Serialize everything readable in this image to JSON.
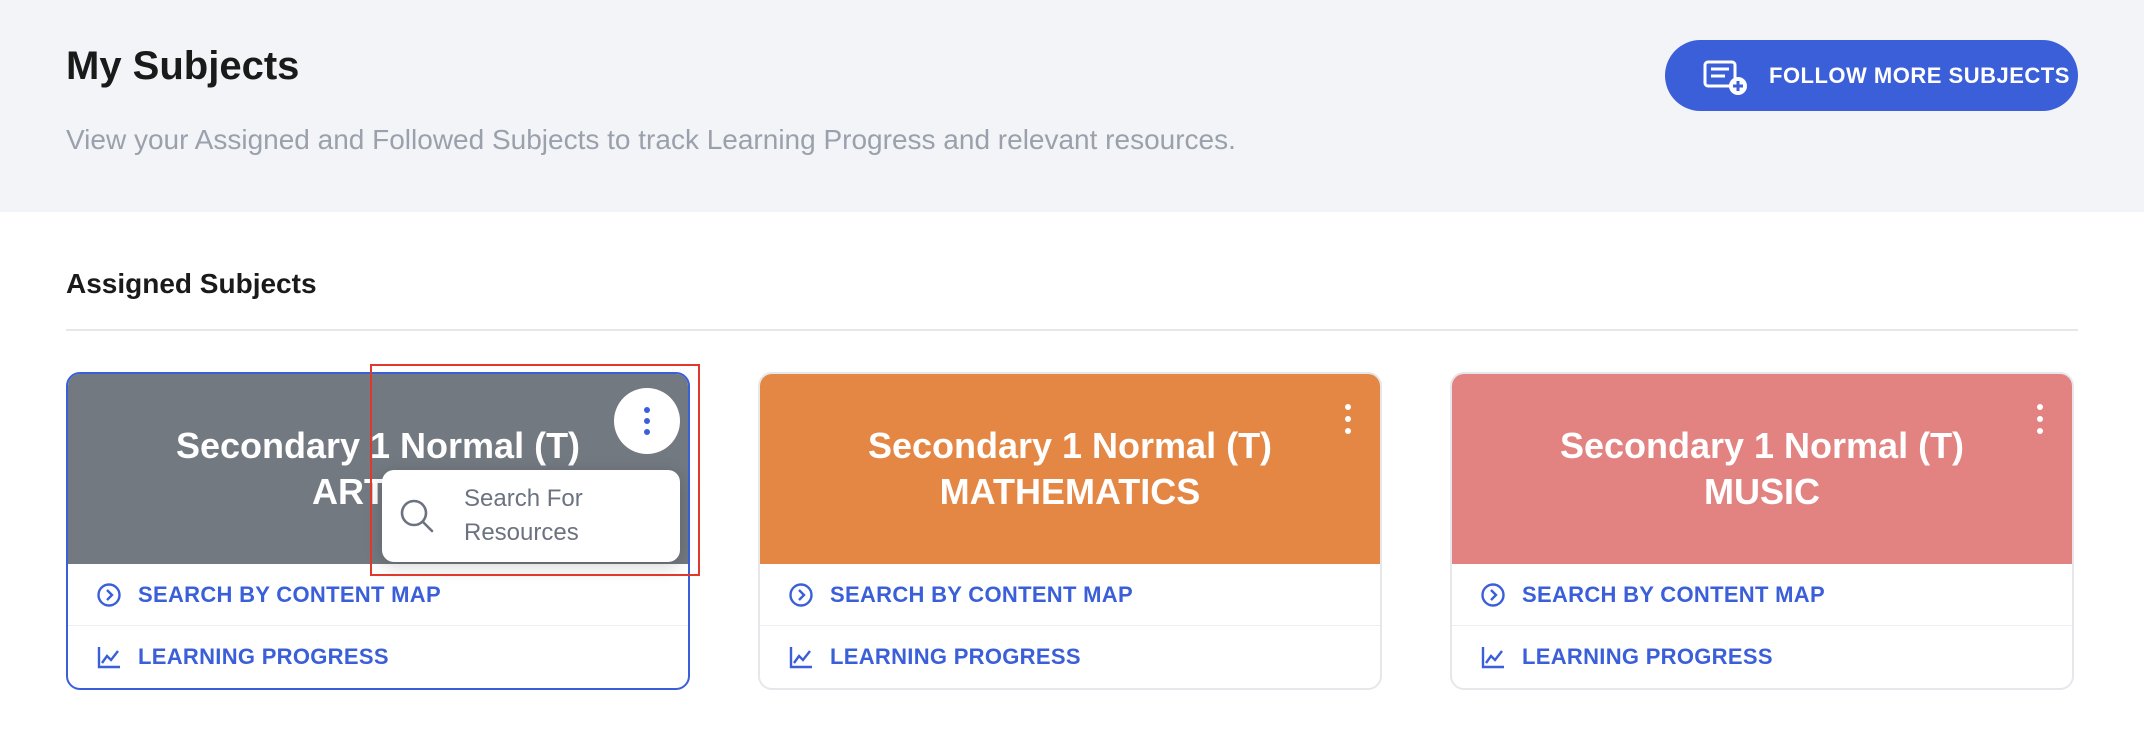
{
  "header": {
    "title": "My Subjects",
    "subtitle": "View your Assigned and Followed Subjects to track Learning Progress and relevant resources.",
    "follow_button_label": "FOLLOW MORE SUBJECTS"
  },
  "section": {
    "title": "Assigned Subjects"
  },
  "cards": [
    {
      "line1": "Secondary 1 Normal (T)",
      "line2": "ART NT",
      "color": "#737980",
      "content_map_label": "SEARCH BY CONTENT MAP",
      "progress_label": "LEARNING PROGRESS"
    },
    {
      "line1": "Secondary 1 Normal (T)",
      "line2": "MATHEMATICS",
      "color": "#e58744",
      "content_map_label": "SEARCH BY CONTENT MAP",
      "progress_label": "LEARNING PROGRESS"
    },
    {
      "line1": "Secondary 1 Normal (T)",
      "line2": "MUSIC",
      "color": "#e28281",
      "content_map_label": "SEARCH BY CONTENT MAP",
      "progress_label": "LEARNING PROGRESS"
    }
  ],
  "popover": {
    "label": "Search For Resources"
  },
  "colors": {
    "accent": "#3a5fd9",
    "highlight": "#e0392b"
  }
}
